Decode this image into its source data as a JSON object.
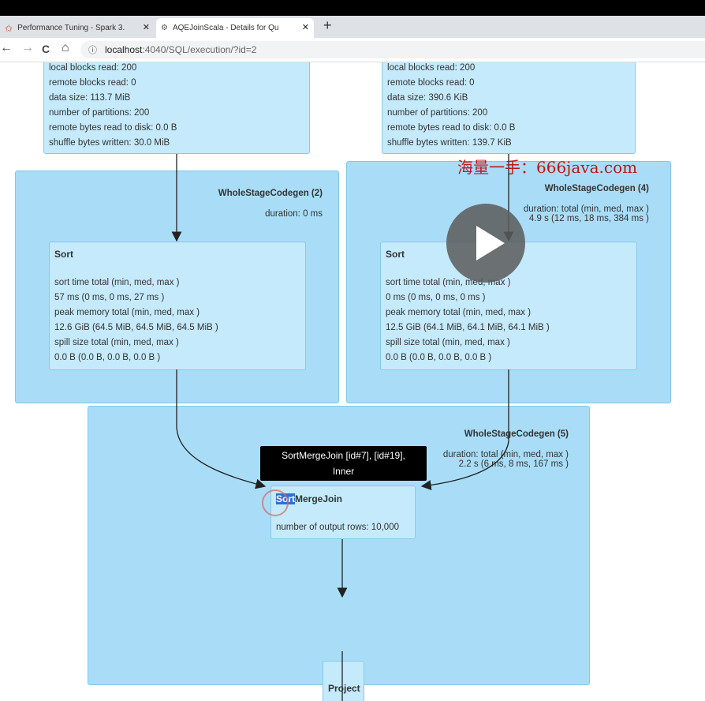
{
  "browser": {
    "top_strip_text": "",
    "tabs": [
      {
        "title": "Performance Tuning - Spark 3.",
        "active": false,
        "icon": "spark-star-icon"
      },
      {
        "title": "AQEJoinScala - Details for Qu",
        "active": true,
        "icon": "spark-logo-icon"
      }
    ],
    "new_tab": "+",
    "nav": {
      "back": "←",
      "forward": "→",
      "reload": "C",
      "home": "⌂"
    },
    "url_host": "localhost",
    "url_path": ":4040/SQL/execution/?id=2"
  },
  "plan": {
    "top_left_node": {
      "lines": [
        "local blocks read: 200",
        "remote blocks read: 0",
        "data size: 113.7 MiB",
        "number of partitions: 200",
        "remote bytes read to disk: 0.0 B",
        "shuffle bytes written: 30.0 MiB"
      ]
    },
    "top_right_node": {
      "lines": [
        "local blocks read: 200",
        "remote blocks read: 0",
        "data size: 390.6 KiB",
        "number of partitions: 200",
        "remote bytes read to disk: 0.0 B",
        "shuffle bytes written: 139.7 KiB"
      ]
    },
    "wsc2": {
      "title": "WholeStageCodegen (2)",
      "duration": "duration: 0 ms",
      "sort": {
        "title": "Sort",
        "lines": [
          "sort time total (min, med, max )",
          "57 ms (0 ms, 0 ms, 27 ms )",
          "peak memory total (min, med, max )",
          "12.6 GiB (64.5 MiB, 64.5 MiB, 64.5 MiB )",
          "spill size total (min, med, max )",
          "0.0 B (0.0 B, 0.0 B, 0.0 B )"
        ]
      }
    },
    "wsc4": {
      "title": "WholeStageCodegen (4)",
      "duration_1": "duration: total (min, med, max )",
      "duration_2": "4.9 s (12 ms, 18 ms, 384 ms )",
      "sort": {
        "title": "Sort",
        "lines": [
          "sort time total (min, med, max )",
          "0 ms (0 ms, 0 ms, 0 ms )",
          "peak memory total (min, med, max )",
          "12.5 GiB (64.1 MiB, 64.1 MiB, 64.1 MiB )",
          "spill size total (min, med, max )",
          "0.0 B (0.0 B, 0.0 B, 0.0 B )"
        ]
      }
    },
    "wsc5": {
      "title": "WholeStageCodegen (5)",
      "duration_1": "duration: total (min, med, max )",
      "duration_2": "2.2 s (6 ms, 8 ms, 167 ms )",
      "smj": {
        "title_highlight": "Sort",
        "title_rest": "MergeJoin",
        "line": "number of output rows: 10,000"
      },
      "project": {
        "title": "Project"
      }
    },
    "tooltip": {
      "line1": "SortMergeJoin [id#7], [id#19],",
      "line2": "Inner"
    }
  },
  "overlay": {
    "watermark": "海量一手：666java.com",
    "play_icon": "play-button-icon"
  },
  "colors": {
    "cluster_fill": "#a9ddf7",
    "node_fill": "#c5eafc",
    "edge": "#222222",
    "watermark": "#c0151b"
  }
}
